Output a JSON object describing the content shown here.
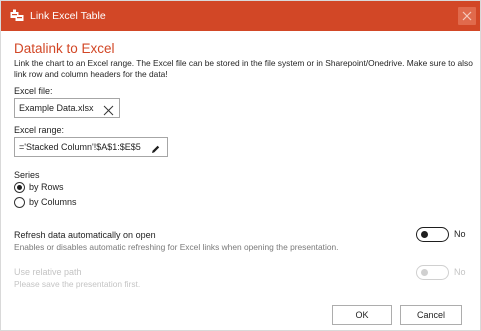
{
  "window": {
    "title": "Link Excel Table",
    "app_icon": "excel-link-icon",
    "close_icon": "close-icon",
    "accent_color": "#d24726"
  },
  "main": {
    "heading": "Datalink to Excel",
    "description": "Link the chart to an Excel range. The Excel file can be stored in the file system or in Sharepoint/Onedrive. Make sure to also link row and column headers for the data!",
    "excel_file": {
      "label": "Excel file:",
      "value": "Example Data.xlsx",
      "remove_icon": "close-icon"
    },
    "excel_range": {
      "label": "Excel range:",
      "value": "='Stacked Column'!$A$1:$E$5",
      "edit_icon": "pencil-icon"
    },
    "series": {
      "label": "Series",
      "options": [
        {
          "label": "by Rows",
          "checked": true
        },
        {
          "label": "by Columns",
          "checked": false
        }
      ]
    },
    "refresh": {
      "label": "Refresh data automatically on open",
      "description": "Enables or disables automatic refreshing for Excel links when opening the presentation.",
      "toggle_label": "No",
      "on": false
    },
    "relative_path": {
      "label": "Use relative path",
      "description": "Please save the presentation first.",
      "toggle_label": "No",
      "on": false,
      "enabled": false
    }
  },
  "footer": {
    "ok_label": "OK",
    "cancel_label": "Cancel"
  }
}
